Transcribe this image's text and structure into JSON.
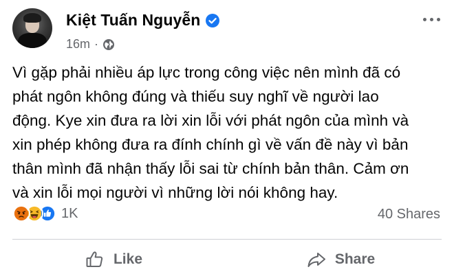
{
  "post": {
    "author": "Kiệt Tuấn Nguyễn",
    "time": "16m",
    "separator": "·",
    "text_lines": [
      "Vì gặp phải nhiều áp lực trong công việc nên mình đã có",
      "phát ngôn không đúng và thiếu suy nghĩ về người lao",
      "động. Kye xin đưa ra lời xin lỗi với phát ngôn của mình và",
      "xin phép không đưa ra đính chính gì về vấn đề này vì bản",
      "thân mình đã nhận thấy lỗi sai từ chính bản thân. Cảm ơn",
      "và xin lỗi mọi người vì những lời nói không hay."
    ]
  },
  "reactions": {
    "icons": [
      "angry-icon",
      "haha-icon",
      "like-icon"
    ],
    "count": "1K",
    "shares": "40 Shares"
  },
  "actions": {
    "like": "Like",
    "share": "Share"
  },
  "colors": {
    "verified": "#1877f2",
    "angry": "#e9710f",
    "haha": "#f7b928",
    "like": "#1877f2",
    "muted": "#65676b"
  }
}
